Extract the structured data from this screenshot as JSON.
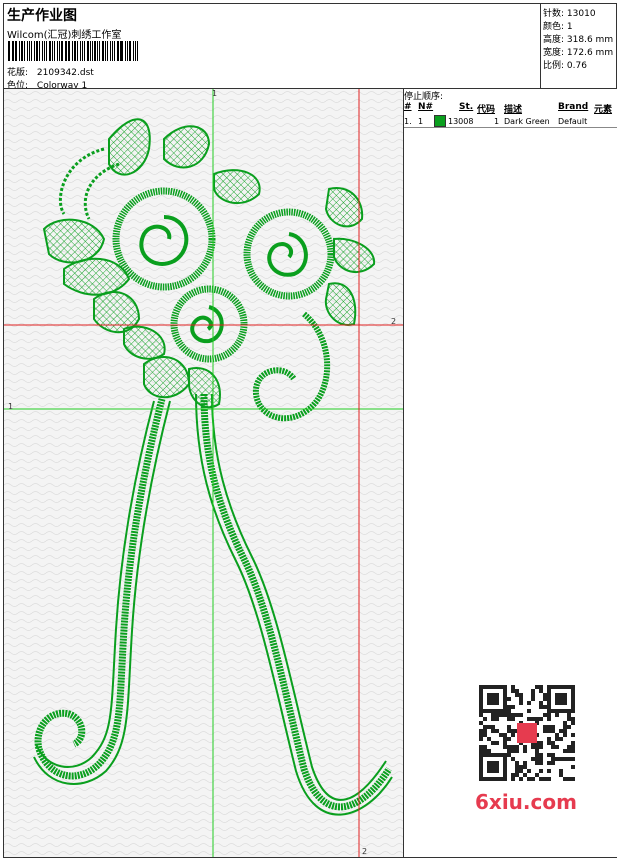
{
  "header": {
    "title": "生产作业图",
    "company": "Wilcom(汇冠)刺绣工作室",
    "design_label": "花版:",
    "design_file": "2109342.dst",
    "colorway_label": "色位:",
    "colorway": "Colorway 1"
  },
  "stats": {
    "stitches_label": "针数:",
    "stitches": "13010",
    "colors_label": "颜色:",
    "colors": "1",
    "height_label": "高度:",
    "height": "318.6 mm",
    "width_label": "宽度:",
    "width": "172.6 mm",
    "scale_label": "比例:",
    "scale": "0.76"
  },
  "stop_sequence": {
    "title": "停止顺序:",
    "columns": [
      "#",
      "N#",
      "St.",
      "代码",
      "描述",
      "Brand",
      "元素"
    ],
    "rows": [
      {
        "index": "1.",
        "needle": "1",
        "stitches": "13008",
        "code": "1",
        "description": "Dark Green",
        "brand": "Default",
        "swatch_color": "#0a9f1e"
      }
    ]
  },
  "guides": {
    "green_label_top": "1",
    "green_label_left": "1",
    "red_label_right": "2",
    "red_label_bottom": "2"
  },
  "colors": {
    "thread": "#0a9f1e",
    "guide_green": "#22cc22",
    "guide_red": "#e02020"
  },
  "watermark": {
    "text": "6xiu.com"
  }
}
